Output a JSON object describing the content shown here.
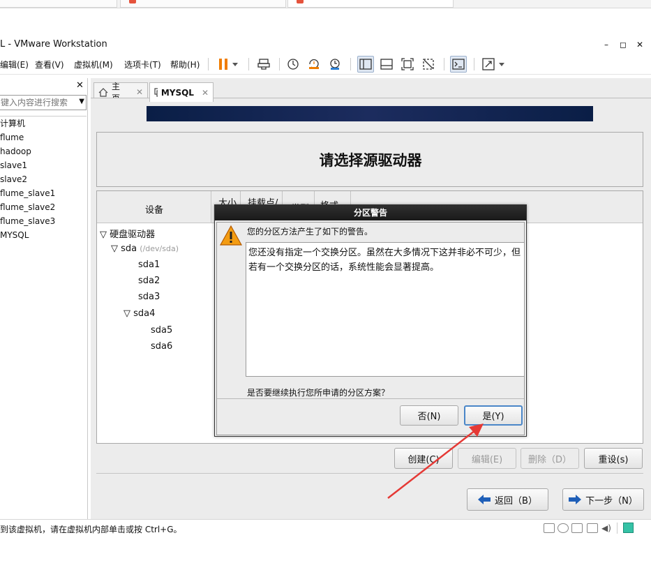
{
  "window": {
    "title": "L - VMware Workstation"
  },
  "menu": [
    "编辑(E)",
    "查看(V)",
    "虚拟机(M)",
    "选项卡(T)",
    "帮助(H)"
  ],
  "sidebar": {
    "search_placeholder": "键入内容进行搜索",
    "items": [
      "计算机",
      "flume",
      "hadoop",
      "slave1",
      "slave2",
      "flume_slave1",
      "flume_slave2",
      "flume_slave3",
      "MYSQL"
    ]
  },
  "tabs": [
    {
      "label": "主页"
    },
    {
      "label": "MYSQL"
    }
  ],
  "installer": {
    "heading": "请选择源驱动器",
    "columns": {
      "device": "设备",
      "size": "大小",
      "mount": "挂载点/",
      "type": "类型",
      "format": "格式"
    },
    "tree": {
      "disks": "硬盘驱动器",
      "sda": "sda",
      "sda_path": "(/dev/sda)",
      "partitions": [
        "sda1",
        "sda2",
        "sda3",
        "sda4"
      ],
      "logical": [
        "sda5",
        "sda6"
      ]
    },
    "buttons": {
      "create": "创建(C)",
      "edit": "编辑(E)",
      "delete": "删除（D）",
      "reset": "重设(s)",
      "back": "返回（B）",
      "next": "下一步（N）"
    }
  },
  "dialog": {
    "title": "分区警告",
    "header": "您的分区方法产生了如下的警告。",
    "warning": "您还没有指定一个交换分区。虽然在大多情况下这并非必不可少，但若有一个交换分区的话，系统性能会显著提高。",
    "question": "是否要继续执行您所申请的分区方案？",
    "no": "否(N)",
    "yes": "是(Y)"
  },
  "statusbar": {
    "text": "到该虚拟机，请在虚拟机内部单击或按 Ctrl+G。"
  },
  "colors": {
    "annotation_arrow": "#e53935",
    "banner": "#0f2350",
    "warning_icon": "#f39c12"
  }
}
